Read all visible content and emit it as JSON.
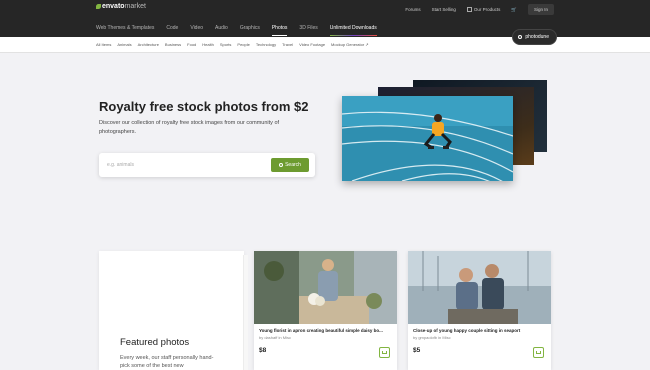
{
  "brand": {
    "logo_main": "envato",
    "logo_sub": "market"
  },
  "top_links": {
    "forums": "Forums",
    "start_selling": "Start Selling",
    "our_products": "Our Products",
    "sign_in": "Sign In"
  },
  "categories": [
    {
      "label": "Web Themes & Templates"
    },
    {
      "label": "Code"
    },
    {
      "label": "Video"
    },
    {
      "label": "Audio"
    },
    {
      "label": "Graphics"
    },
    {
      "label": "Photos"
    },
    {
      "label": "3D Files"
    },
    {
      "label": "Unlimited Downloads"
    }
  ],
  "subnav": [
    {
      "label": "All Items"
    },
    {
      "label": "Animals"
    },
    {
      "label": "Architecture"
    },
    {
      "label": "Business"
    },
    {
      "label": "Food"
    },
    {
      "label": "Health"
    },
    {
      "label": "Sports"
    },
    {
      "label": "People"
    },
    {
      "label": "Technology"
    },
    {
      "label": "Travel"
    },
    {
      "label": "Video Footage"
    },
    {
      "label": "Mockup Generator ↗"
    }
  ],
  "photodune_label": "photodune",
  "hero": {
    "title": "Royalty free stock photos from $2",
    "subtitle": "Discover our collection of royalty free stock images from our community of photographers.",
    "search_placeholder": "e.g. animals",
    "search_button": "Search"
  },
  "featured": {
    "title": "Featured photos",
    "description": "Every week, our staff personally hand-pick some of the best new"
  },
  "items": [
    {
      "title": "Young florist in apron creating beautiful simple daisy bo...",
      "author": "by dashaff in Misc",
      "price": "$8"
    },
    {
      "title": "Close-up of young happy couple sitting in seaport",
      "author": "by gmpaolofb in Misc",
      "price": "$5"
    }
  ],
  "colors": {
    "accent": "#82b541",
    "button": "#6d9b30",
    "topbar": "#262626"
  }
}
